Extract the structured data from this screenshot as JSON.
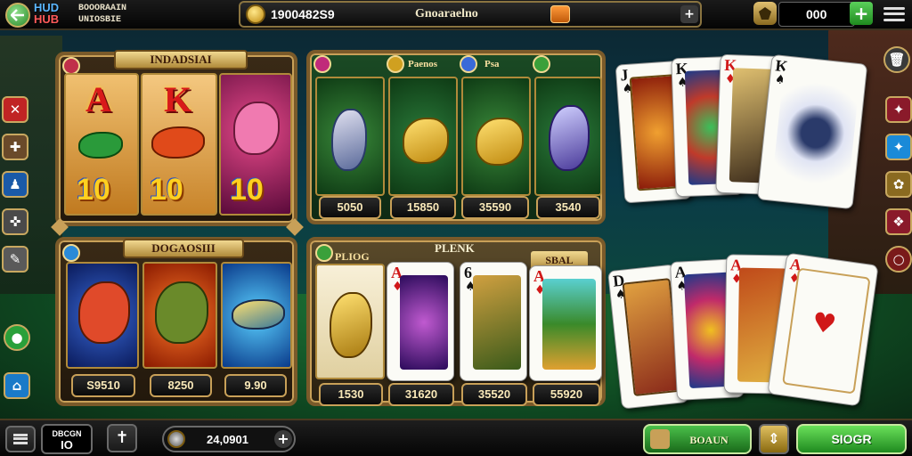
{
  "header": {
    "logo_line1": "HUD",
    "logo_line2": "HUB",
    "subtitle_line1": "BOOORAAIN",
    "subtitle_line2": "UNIOSBIE",
    "balance_value": "1900482S9",
    "balance_title": "Gnoaraelno",
    "gems_value": "000",
    "plus": "+"
  },
  "panels": {
    "top_left": {
      "title": "INDADSIAI",
      "symbols": [
        "A",
        "K",
        "10",
        "10"
      ]
    },
    "top_middle": {
      "label_a": "Paenos",
      "label_b": "Psa",
      "values": [
        "5050",
        "15850",
        "35590",
        "3540"
      ]
    },
    "bottom_left": {
      "title": "DOGAOSIII",
      "values": [
        "S9510",
        "8250",
        "9.90"
      ]
    },
    "bottom_middle": {
      "label_a": "PLIOG",
      "label_b": "PLENK",
      "label_c": "SBAL",
      "values": [
        "1530",
        "31620",
        "35520",
        "55920"
      ]
    }
  },
  "cards_top": [
    {
      "rank": "J",
      "suit": "♠",
      "color": "#111"
    },
    {
      "rank": "K",
      "suit": "♠",
      "color": "#111"
    },
    {
      "rank": "K",
      "suit": "♦",
      "color": "#d01818"
    },
    {
      "rank": "K",
      "suit": "♠",
      "color": "#111"
    }
  ],
  "cards_bottom": [
    {
      "rank": "D",
      "suit": "♠",
      "color": "#111"
    },
    {
      "rank": "A",
      "suit": "♠",
      "color": "#111"
    },
    {
      "rank": "A",
      "suit": "♦",
      "color": "#d01818"
    },
    {
      "rank": "A",
      "suit": "♦",
      "color": "#d01818"
    }
  ],
  "card_center_suit": "♥",
  "panel_cards": [
    {
      "rank": "A",
      "suit": "♦"
    },
    {
      "rank": "6",
      "suit": "♠"
    },
    {
      "rank": "A",
      "suit": "♦"
    }
  ],
  "footer": {
    "bet_label_line1": "DBCGN",
    "bet_label_line2": "IO",
    "total_value": "24,0901",
    "action_label": "BOAUN",
    "spin_label": "SIOGR"
  },
  "icons": {
    "back": "back-arrow-icon",
    "coin": "coin-icon",
    "gift": "gift-icon",
    "gems": "gem-icon",
    "menu": "menu-icon",
    "trash": "trash-icon"
  },
  "colors": {
    "accent_gold": "#c8a058",
    "spin_green": "#1f8a1f",
    "card_red": "#d01818"
  }
}
